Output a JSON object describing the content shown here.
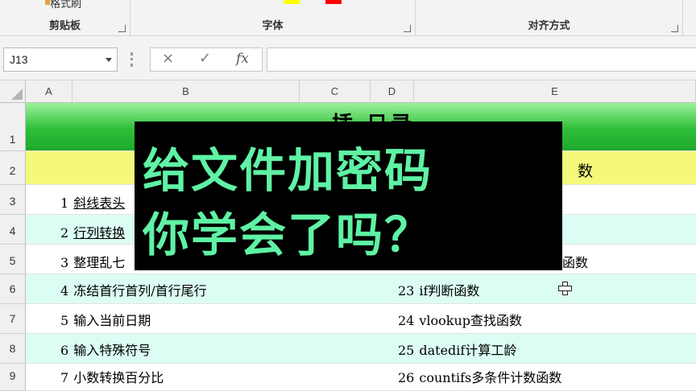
{
  "ribbon": {
    "format_painter_label": "格式刷",
    "groups": [
      {
        "label": "剪贴板"
      },
      {
        "label": "字体"
      },
      {
        "label": "对齐方式"
      }
    ],
    "colors": {
      "highlight_yellow": "#ffff00",
      "font_red": "#ff0000"
    }
  },
  "formula_bar": {
    "name_box": "J13",
    "cancel_icon": "×",
    "enter_icon": "✓",
    "fx_label": "fx",
    "content": ""
  },
  "columns": [
    "A",
    "B",
    "C",
    "D",
    "E"
  ],
  "rows": [
    "1",
    "2",
    "3",
    "4",
    "5",
    "6",
    "7",
    "8",
    "9"
  ],
  "sheet": {
    "title_partial": "插  日录",
    "row2_tail": "数",
    "left_items": [
      {
        "num": "1",
        "text": "斜线表头",
        "link": true
      },
      {
        "num": "2",
        "text": "行列转换",
        "link": true
      },
      {
        "num": "3",
        "text": "整理乱七",
        "link": false
      },
      {
        "num": "4",
        "text": "冻结首行首列/首行尾行",
        "link": false
      },
      {
        "num": "5",
        "text": "输入当前日期",
        "link": false
      },
      {
        "num": "6",
        "text": "输入特殊符号",
        "link": false
      },
      {
        "num": "7",
        "text": "小数转换百分比",
        "link": false
      }
    ],
    "right_items": [
      {
        "num": "",
        "text": ""
      },
      {
        "num": "",
        "text": ""
      },
      {
        "num": "",
        "text": "函数"
      },
      {
        "num": "23",
        "text": "if判断函数"
      },
      {
        "num": "24",
        "text": "vlookup查找函数"
      },
      {
        "num": "25",
        "text": "datedif计算工龄"
      },
      {
        "num": "26",
        "text": "countifs多条件计数函数"
      }
    ],
    "colors": {
      "header_green": "#2fbf3a",
      "header_yellow": "#f5f97a",
      "band_cyan": "#dcfdf4"
    }
  },
  "banner": {
    "line1": "给文件加密码",
    "line2": "你学会了吗？",
    "colors": {
      "background": "#000000",
      "text": "#5ff2a5"
    }
  }
}
